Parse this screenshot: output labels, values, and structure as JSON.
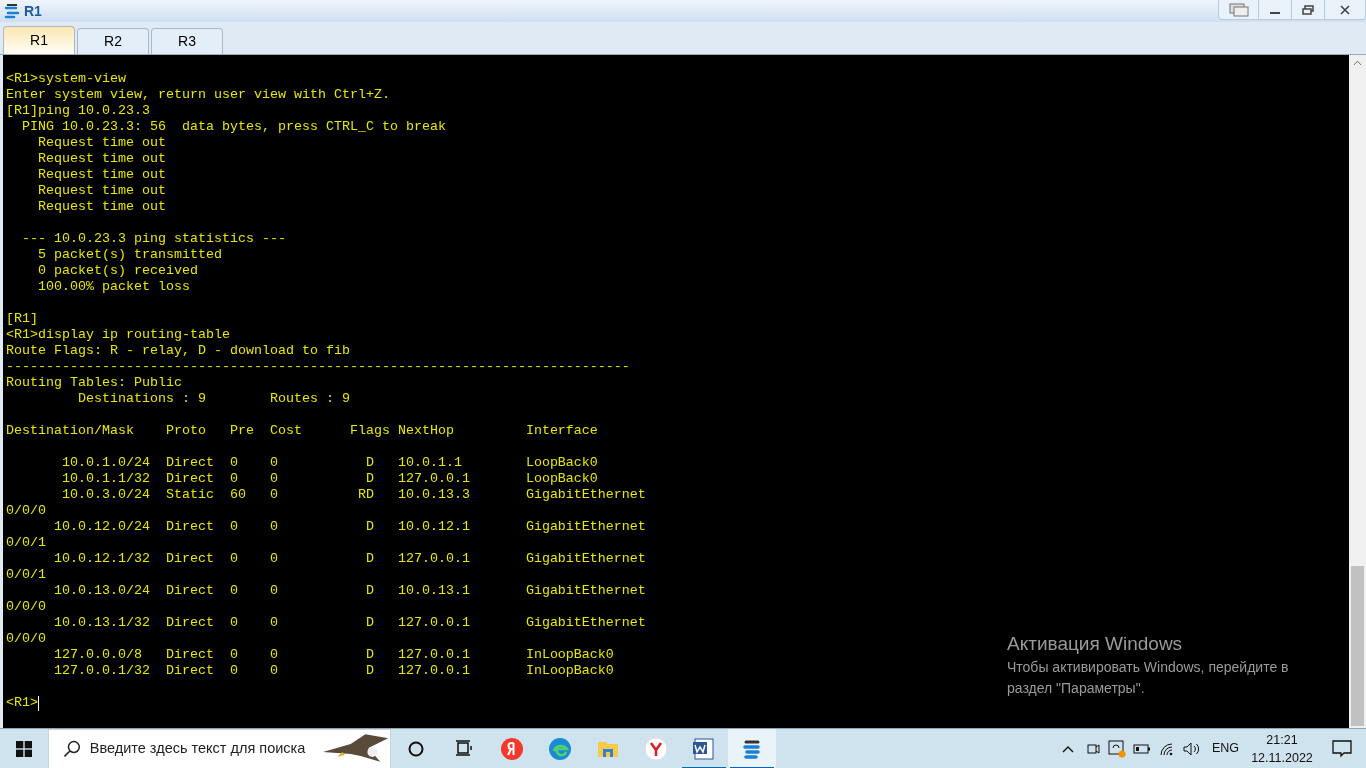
{
  "window": {
    "title": "R1"
  },
  "tabs": [
    {
      "label": "R1",
      "selected": true
    },
    {
      "label": "R2",
      "selected": false
    },
    {
      "label": "R3",
      "selected": false
    }
  ],
  "terminal": {
    "blocks": [
      [
        "<R1>system-view",
        "Enter system view, return user view with Ctrl+Z.",
        "[R1]ping 10.0.23.3",
        "  PING 10.0.23.3: 56  data bytes, press CTRL_C to break",
        "    Request time out",
        "    Request time out",
        "    Request time out",
        "    Request time out",
        "    Request time out"
      ],
      [
        "  --- 10.0.23.3 ping statistics ---",
        "    5 packet(s) transmitted",
        "    0 packet(s) received",
        "    100.00% packet loss"
      ],
      [
        "[R1]",
        "<R1>display ip routing-table",
        "Route Flags: R - relay, D - download to fib",
        "------------------------------------------------------------------------------",
        "Routing Tables: Public",
        "         Destinations : 9        Routes : 9"
      ],
      [
        "Destination/Mask    Proto   Pre  Cost      Flags NextHop         Interface"
      ],
      [
        "       10.0.1.0/24  Direct  0    0           D   10.0.1.1        LoopBack0",
        "       10.0.1.1/32  Direct  0    0           D   127.0.0.1       LoopBack0",
        "       10.0.3.0/24  Static  60   0          RD   10.0.13.3       GigabitEthernet",
        "0/0/0",
        "      10.0.12.0/24  Direct  0    0           D   10.0.12.1       GigabitEthernet",
        "0/0/1",
        "      10.0.12.1/32  Direct  0    0           D   127.0.0.1       GigabitEthernet",
        "0/0/1",
        "      10.0.13.0/24  Direct  0    0           D   10.0.13.1       GigabitEthernet",
        "0/0/0",
        "      10.0.13.1/32  Direct  0    0           D   127.0.0.1       GigabitEthernet",
        "0/0/0",
        "      127.0.0.0/8   Direct  0    0           D   127.0.0.1       InLoopBack0",
        "      127.0.0.1/32  Direct  0    0           D   127.0.0.1       InLoopBack0"
      ],
      [
        "<R1>"
      ]
    ],
    "cursor": true
  },
  "activation_notice": {
    "title": "Активация Windows",
    "lines": [
      "Чтобы активировать Windows, перейдите в",
      "раздел \"Параметры\"."
    ]
  },
  "taskbar": {
    "search": {
      "placeholder": "Введите здесь текст для поиска"
    },
    "apps": [
      {
        "kind": "cortana",
        "running": false,
        "selected": false
      },
      {
        "kind": "taskview",
        "running": false,
        "selected": false
      },
      {
        "kind": "yandex",
        "running": false,
        "selected": false
      },
      {
        "kind": "edge",
        "running": false,
        "selected": false
      },
      {
        "kind": "explorer",
        "running": false,
        "selected": false
      },
      {
        "kind": "ybrowser",
        "running": false,
        "selected": false
      },
      {
        "kind": "word",
        "running": true,
        "selected": false
      },
      {
        "kind": "ensp",
        "running": true,
        "selected": true
      }
    ],
    "language": "ENG",
    "time": "21:21",
    "date": "12.11.2022"
  }
}
